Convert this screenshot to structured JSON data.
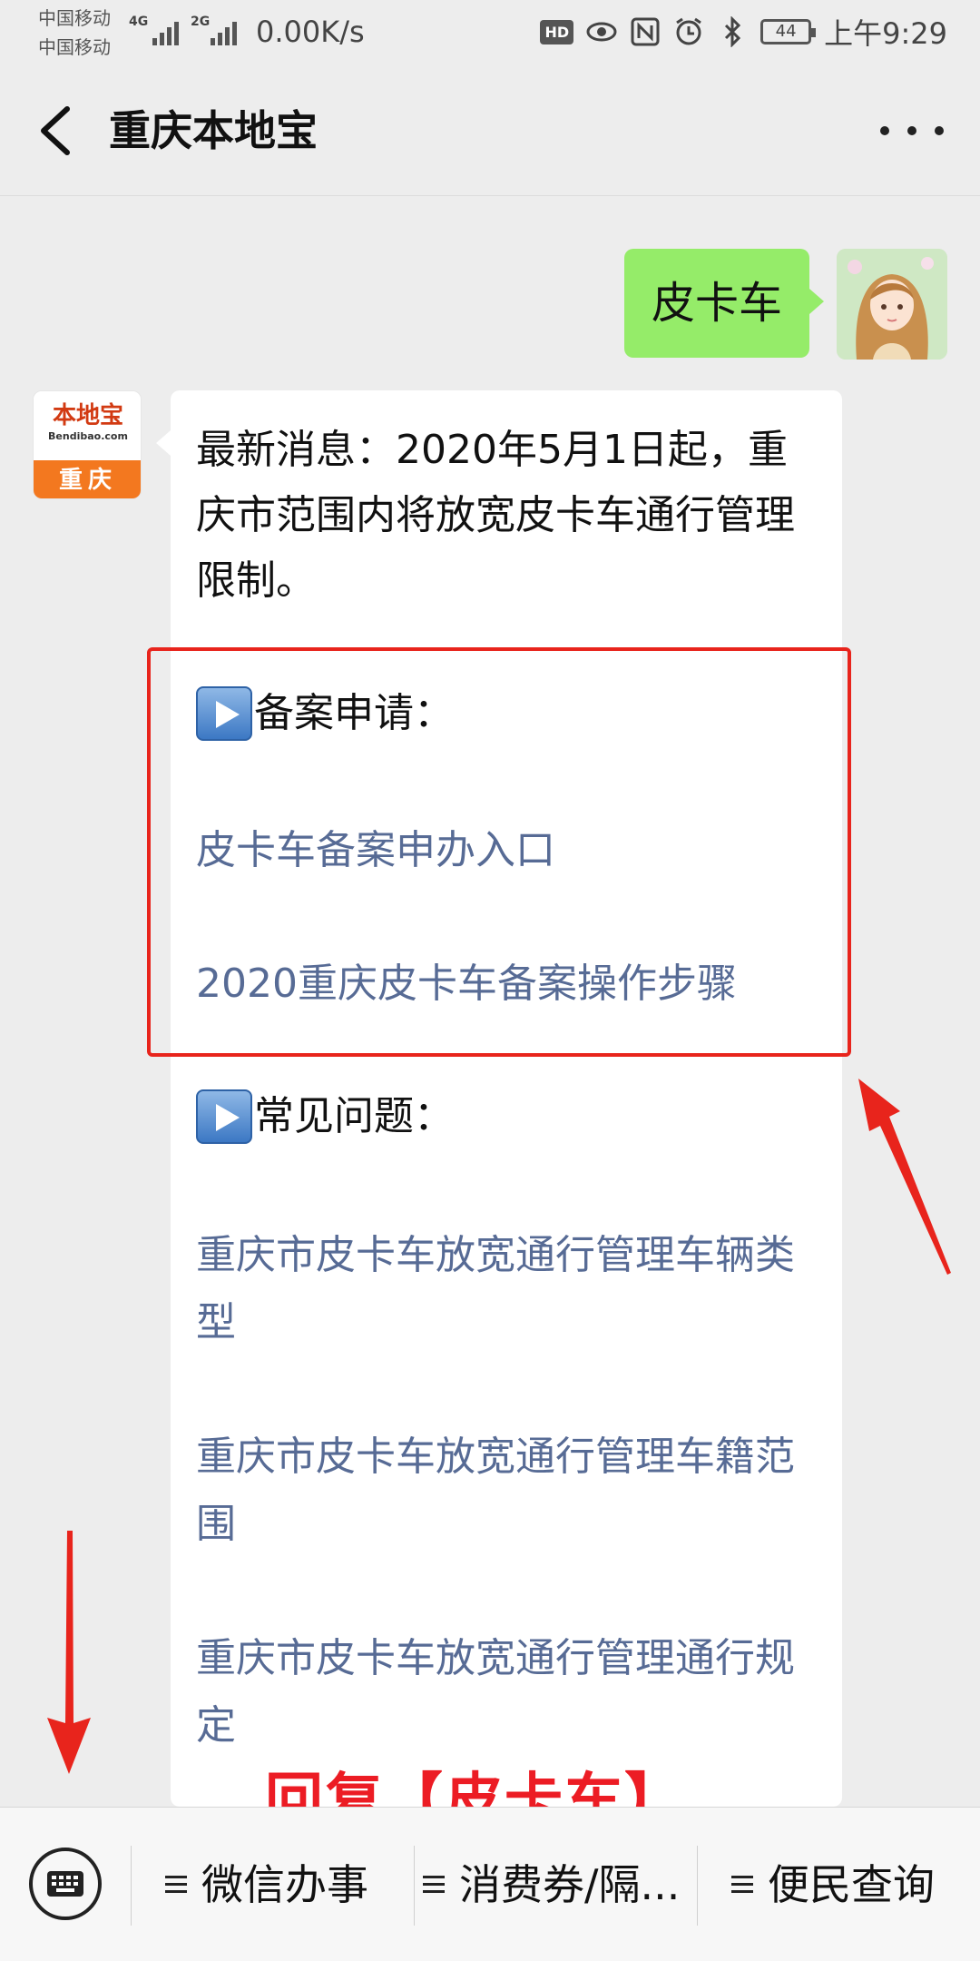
{
  "status_bar": {
    "carrier1": "中国移动",
    "carrier2": "中国移动",
    "net1": "4G",
    "net2": "2G",
    "speed": "0.00K/s",
    "hd": "HD",
    "battery": "44",
    "time": "上午9:29",
    "icons": [
      "eye-icon",
      "nfc-icon",
      "alarm-icon",
      "bluetooth-icon"
    ]
  },
  "nav": {
    "title": "重庆本地宝",
    "back_icon": "chevron-left-icon",
    "more_icon": "more-dots-icon"
  },
  "chat": {
    "user_message": "皮卡车",
    "bot_avatar": {
      "brand": "本地宝",
      "domain": "Bendibao.com",
      "city": "重庆"
    },
    "bot_message": {
      "intro": "最新消息：2020年5月1日起，重庆市范围内将放宽皮卡车通行管理限制。",
      "sections": [
        {
          "heading": "备案申请：",
          "links": [
            "皮卡车备案申办入口",
            "2020重庆皮卡车备案操作步骤"
          ]
        },
        {
          "heading": "常见问题：",
          "links": [
            "重庆市皮卡车放宽通行管理车辆类型",
            "重庆市皮卡车放宽通行管理车籍范围",
            "重庆市皮卡车放宽通行管理通行规定"
          ]
        }
      ]
    }
  },
  "annotation": {
    "reply_hint": "回复【皮卡车】",
    "color": "#ec1c24"
  },
  "bottom_bar": {
    "keyboard_icon": "keyboard-icon",
    "menus": [
      "微信办事",
      "消费券/隔...",
      "便民查询"
    ]
  },
  "colors": {
    "background": "#ededed",
    "my_bubble": "#95ec69",
    "link": "#576b95",
    "highlight": "#e8241c"
  }
}
